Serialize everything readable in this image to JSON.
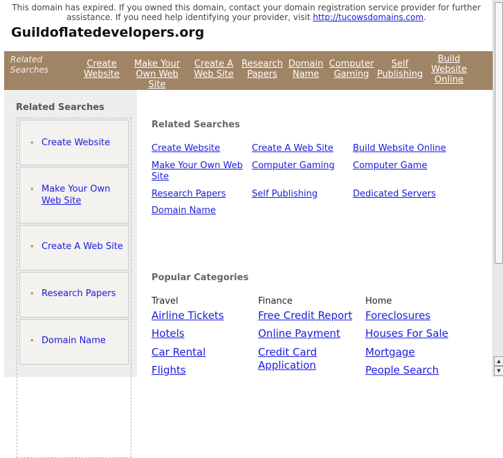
{
  "notice": {
    "line1": "This domain has expired. If you owned this domain, contact your domain registration service provider for further",
    "line2_prefix": "assistance. If you need help identifying your provider, visit ",
    "line2_link": "http://tucowsdomains.com",
    "line2_suffix": "."
  },
  "site_title": "Guildoflatedevelopers.org",
  "nav": {
    "label_line1": "Related",
    "label_line2": "Searches",
    "items": [
      {
        "l1": "Create",
        "l2": "Website"
      },
      {
        "l1": "Make Your",
        "l2": "Own Web Site"
      },
      {
        "l1": "Create A",
        "l2": "Web Site"
      },
      {
        "l1": "Research",
        "l2": "Papers"
      },
      {
        "l1": "Domain",
        "l2": "Name"
      },
      {
        "l1": "Computer",
        "l2": "Gaming"
      },
      {
        "l1": "Self",
        "l2": "Publishing"
      },
      {
        "l1": "Build",
        "l2": "Website",
        "l3": "Online"
      }
    ]
  },
  "sidebar": {
    "title": "Related Searches",
    "bullet": "•",
    "items": [
      {
        "l1": "Create Website"
      },
      {
        "l1": "Make Your Own",
        "l2": "Web Site"
      },
      {
        "l1": "Create A Web Site"
      },
      {
        "l1": "Research Papers"
      },
      {
        "l1": "Domain Name"
      }
    ]
  },
  "main": {
    "related_title": "Related Searches",
    "related_links": [
      {
        "l1": "Create Website"
      },
      {
        "l1": "Create A Web Site"
      },
      {
        "l1": "Build Website Online"
      },
      {
        "l1": "Make Your Own Web",
        "l2": "Site"
      },
      {
        "l1": "Computer Gaming"
      },
      {
        "l1": "Computer Game"
      },
      {
        "l1": "Research Papers"
      },
      {
        "l1": "Self Publishing"
      },
      {
        "l1": "Dedicated Servers"
      },
      {
        "l1": "Domain Name"
      }
    ],
    "popular_title": "Popular Categories",
    "categories": [
      {
        "heading": "Travel",
        "links": [
          {
            "l1": "Airline Tickets"
          },
          {
            "l1": "Hotels"
          },
          {
            "l1": "Car Rental"
          },
          {
            "l1": "Flights"
          }
        ]
      },
      {
        "heading": "Finance",
        "links": [
          {
            "l1": "Free Credit Report"
          },
          {
            "l1": "Online Payment"
          },
          {
            "l1": "Credit Card",
            "l2": "Application"
          }
        ]
      },
      {
        "heading": "Home",
        "links": [
          {
            "l1": "Foreclosures"
          },
          {
            "l1": "Houses For Sale"
          },
          {
            "l1": "Mortgage"
          },
          {
            "l1": "People Search"
          }
        ]
      }
    ]
  },
  "scrollbar": {
    "up_arrow": "▲",
    "down_arrow": "▼"
  },
  "colors": {
    "nav_bg": "#a08466",
    "sidebar_bg": "#eeeeee",
    "link": "#1a1adb"
  }
}
